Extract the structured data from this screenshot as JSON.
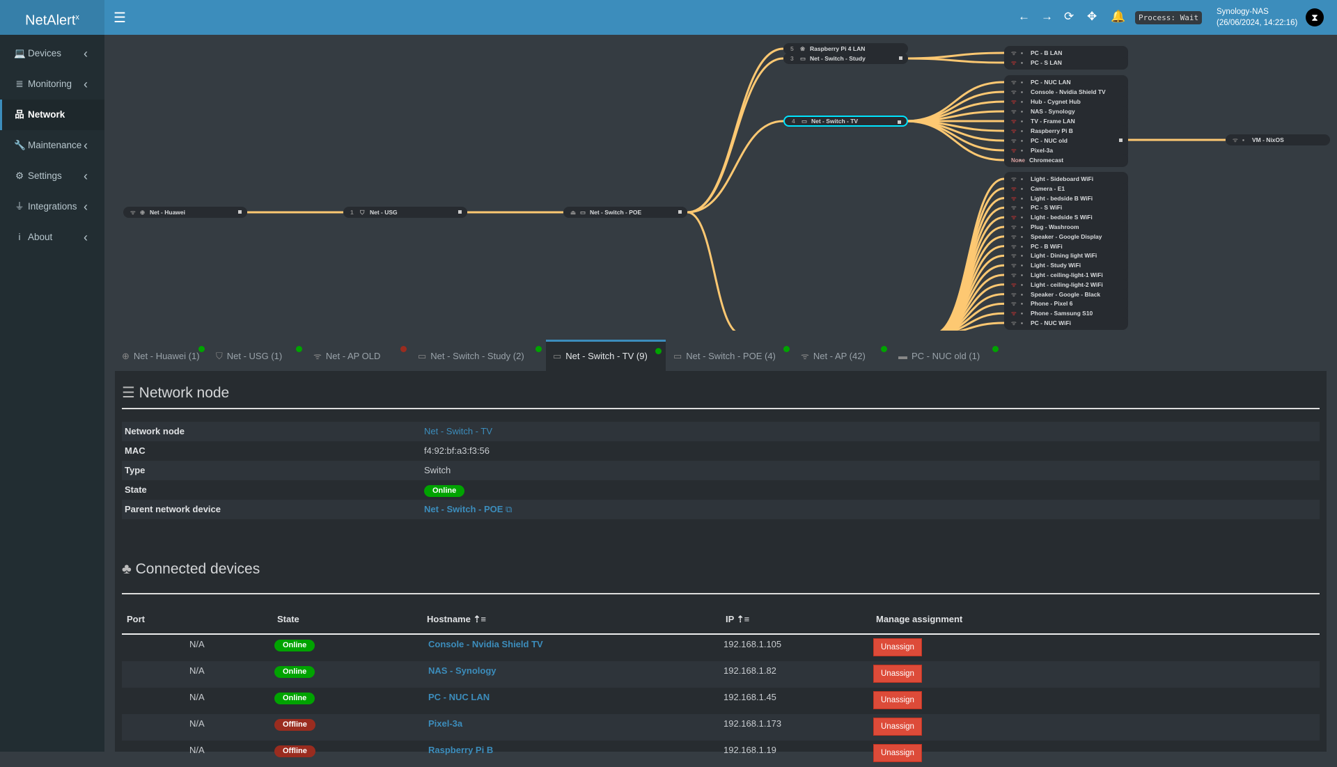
{
  "app": {
    "logo": "NetAlert",
    "logo_sup": "x",
    "menu_icon": "hamburger-icon"
  },
  "header": {
    "process": "Process: Wait",
    "host": "Synology-NAS",
    "datetime": "(26/06/2024, 14:22:16)",
    "icons": [
      "arrow-left-icon",
      "arrow-right-icon",
      "sync-icon",
      "move-icon",
      "bell-icon"
    ]
  },
  "sidebar": {
    "items": [
      {
        "label": "Devices",
        "icon": "laptop-icon",
        "glyph": "💻"
      },
      {
        "label": "Monitoring",
        "icon": "chart-icon",
        "glyph": "≣"
      },
      {
        "label": "Network",
        "icon": "network-icon",
        "glyph": "品",
        "active": true
      },
      {
        "label": "Maintenance",
        "icon": "wrench-icon",
        "glyph": "🔧"
      },
      {
        "label": "Settings",
        "icon": "gear-icon",
        "glyph": "⚙"
      },
      {
        "label": "Integrations",
        "icon": "plug-icon",
        "glyph": "⏚"
      },
      {
        "label": "About",
        "icon": "info-icon",
        "glyph": "i"
      }
    ]
  },
  "tree": {
    "line_color": "#fdc872",
    "chain": [
      {
        "name": "Net - Huawei",
        "n1": "ᯤ",
        "n2": "⊕"
      },
      {
        "name": "Net - USG",
        "n1": "1",
        "n2": "⛉"
      },
      {
        "name": "Net - Switch - POE",
        "n1": "⏏",
        "n2": "▭"
      }
    ],
    "poe_children": [
      {
        "name": "Raspberry Pi 4 LAN",
        "n1": "5",
        "n2": "❀"
      },
      {
        "name": "Net - Switch - Study",
        "n1": "3",
        "n2": "▭"
      },
      {
        "name": "Net - Switch - TV",
        "n1": "4",
        "n2": "▭",
        "selected": true
      }
    ],
    "study_children": [
      {
        "name": "PC - B LAN",
        "on": true
      },
      {
        "name": "PC - S LAN",
        "on": false
      }
    ],
    "tv_children": [
      {
        "name": "PC - NUC LAN",
        "on": true
      },
      {
        "name": "Console - Nvidia Shield TV",
        "on": true
      },
      {
        "name": "Hub - Cygnet Hub",
        "on": false
      },
      {
        "name": "NAS - Synology",
        "on": true
      },
      {
        "name": "TV - Frame LAN",
        "on": false
      },
      {
        "name": "Raspberry Pi B",
        "on": false
      },
      {
        "name": "PC - NUC old",
        "on": true
      },
      {
        "name": "Pixel-3a",
        "on": false
      },
      {
        "name": "Chromecast",
        "on": false,
        "tag": "None"
      }
    ],
    "ap_children": [
      {
        "name": "Light - Sideboard WiFi",
        "on": true
      },
      {
        "name": "Camera - E1",
        "on": false
      },
      {
        "name": "Light - bedside B WiFi",
        "on": false
      },
      {
        "name": "PC - S WiFi",
        "on": true
      },
      {
        "name": "Light - bedside S WiFi",
        "on": false
      },
      {
        "name": "Plug - Washroom",
        "on": true
      },
      {
        "name": "Speaker - Google Display",
        "on": true
      },
      {
        "name": "PC - B WiFi",
        "on": true
      },
      {
        "name": "Light - Dining light WiFi",
        "on": true
      },
      {
        "name": "Light - Study WiFi",
        "on": true
      },
      {
        "name": "Light - ceiling-light-1 WiFi",
        "on": true
      },
      {
        "name": "Light - ceiling-light-2 WiFi",
        "on": false
      },
      {
        "name": "Speaker - Google - Black",
        "on": true
      },
      {
        "name": "Phone - Pixel 6",
        "on": true
      },
      {
        "name": "Phone - Samsung S10",
        "on": false
      },
      {
        "name": "PC - NUC WiFi",
        "on": true
      }
    ],
    "nuc_child": {
      "name": "VM - NixOS",
      "on": true
    }
  },
  "tabs": [
    {
      "label": "Net - Huawei (1)",
      "icon": "globe-icon",
      "glyph": "⊕",
      "status": "online"
    },
    {
      "label": "Net - USG (1)",
      "icon": "shield-icon",
      "glyph": "⛉",
      "status": "online"
    },
    {
      "label": "Net - AP OLD",
      "icon": "wifi-icon",
      "glyph": "ᯤ",
      "status": "offline"
    },
    {
      "label": "Net - Switch - Study (2)",
      "icon": "switch-icon",
      "glyph": "▭",
      "status": "online"
    },
    {
      "label": "Net - Switch - TV (9)",
      "icon": "switch-icon",
      "glyph": "▭",
      "status": "online",
      "active": true
    },
    {
      "label": "Net - Switch - POE (4)",
      "icon": "switch-icon",
      "glyph": "▭",
      "status": "online"
    },
    {
      "label": "Net - AP (42)",
      "icon": "wifi-icon",
      "glyph": "ᯤ",
      "status": "online"
    },
    {
      "label": "PC - NUC old (1)",
      "icon": "mini-pc-icon",
      "glyph": "▬",
      "status": "online"
    }
  ],
  "colors": {
    "online": "#00a300",
    "offline": "#9a2c1f",
    "accent": "#3c8dbc"
  },
  "node": {
    "title": "Network node",
    "rows": [
      {
        "label": "Network node",
        "value": "Net - Switch - TV",
        "type": "link"
      },
      {
        "label": "MAC",
        "value": "f4:92:bf:a3:f3:56"
      },
      {
        "label": "Type",
        "value": "Switch"
      },
      {
        "label": "State",
        "value": "Online",
        "type": "badge"
      },
      {
        "label": "Parent network device",
        "value": "Net - Switch - POE",
        "type": "link"
      }
    ]
  },
  "connected": {
    "title": "Connected devices",
    "headers": [
      "Port",
      "State",
      "Hostname",
      "IP",
      "Manage assignment"
    ],
    "button": "Unassign",
    "rows": [
      {
        "port": "N/A",
        "state": "Online",
        "host": "Console - Nvidia Shield TV",
        "ip": "192.168.1.105"
      },
      {
        "port": "N/A",
        "state": "Online",
        "host": "NAS - Synology",
        "ip": "192.168.1.82"
      },
      {
        "port": "N/A",
        "state": "Online",
        "host": "PC - NUC LAN",
        "ip": "192.168.1.45"
      },
      {
        "port": "N/A",
        "state": "Offline",
        "host": "Pixel-3a",
        "ip": "192.168.1.173"
      },
      {
        "port": "N/A",
        "state": "Offline",
        "host": "Raspberry Pi B",
        "ip": "192.168.1.19"
      }
    ]
  }
}
